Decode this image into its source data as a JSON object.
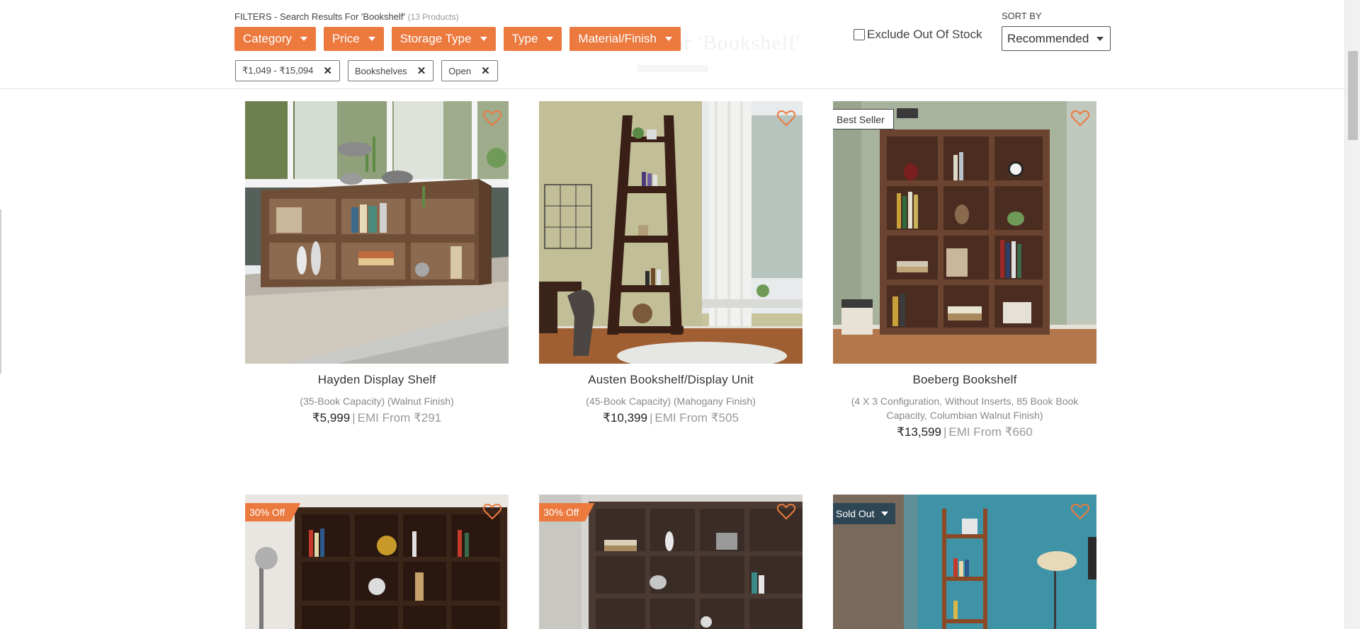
{
  "header": {
    "ghost_title": "Results for 'Bookshelf'",
    "filters_prefix": "FILTERS - Search Results For 'Bookshelf'",
    "product_count": "(13 Products)",
    "dropdowns": [
      "Category",
      "Price",
      "Storage Type",
      "Type",
      "Material/Finish"
    ],
    "exclude_out_of_stock": "Exclude Out Of Stock",
    "sort_label": "SORT BY",
    "sort_value": "Recommended",
    "active_filters": [
      "₹1,049 - ₹15,094",
      "Bookshelves",
      "Open"
    ],
    "accent_color": "#ec7a3f"
  },
  "products": [
    {
      "title": "Hayden Display Shelf",
      "subtitle": "(35-Book Capacity) (Walnut Finish)",
      "price": "₹5,999",
      "emi": "EMI From ₹291",
      "badge": ""
    },
    {
      "title": "Austen Bookshelf/Display Unit",
      "subtitle": "(45-Book Capacity) (Mahogany Finish)",
      "price": "₹10,399",
      "emi": "EMI From ₹505",
      "badge": ""
    },
    {
      "title": "Boeberg Bookshelf",
      "subtitle": "(4 X 3 Configuration, Without Inserts, 85 Book Book Capacity, Columbian Walnut Finish)",
      "price": "₹13,599",
      "emi": "EMI From ₹660",
      "badge": "Best Seller"
    },
    {
      "badge": "30% Off"
    },
    {
      "badge": "30% Off"
    },
    {
      "badge": "Sold Out"
    }
  ],
  "icons": {
    "wishlist": "heart-outline-icon",
    "remove_filter": "close-icon",
    "dropdown": "caret-down-icon"
  }
}
